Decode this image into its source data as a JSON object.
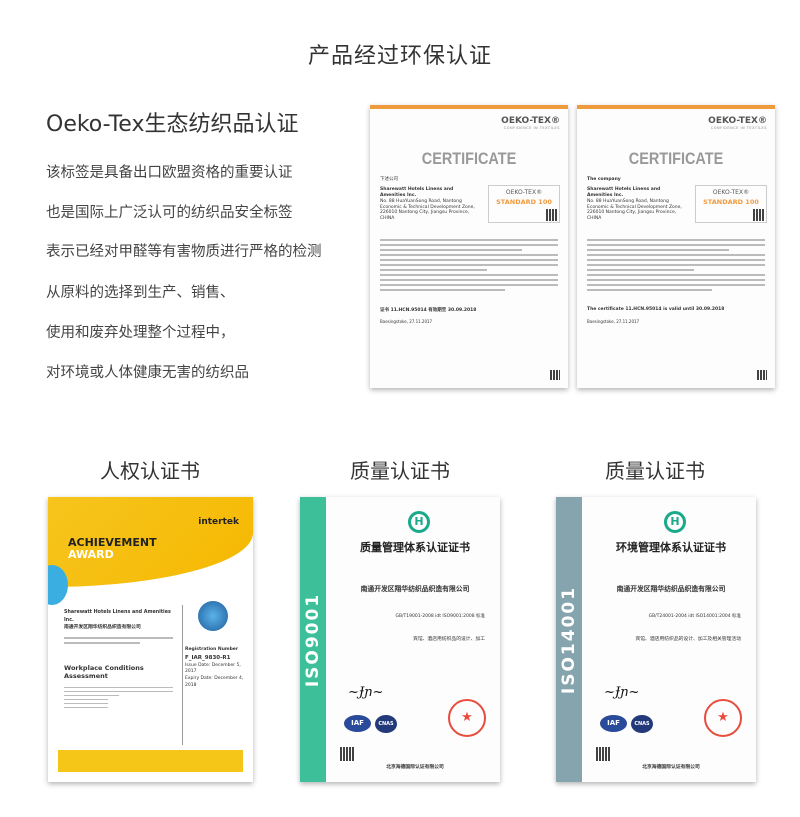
{
  "title": "产品经过环保认证",
  "oeko": {
    "heading": "Oeko-Tex生态纺织品认证",
    "lines": [
      "该标签是具备出口欧盟资格的重要认证",
      "也是国际上广泛认可的纺织品安全标签",
      "表示已经对甲醛等有害物质进行严格的检测",
      "从原料的选择到生产、销售、",
      "使用和废弃处理整个过程中，",
      "对环境或人体健康无害的纺织品"
    ]
  },
  "oeko_certs": [
    {
      "brand": "OEKO-TEX®",
      "tagline": "CONFIDENCE IN TEXTILES",
      "title": "CERTIFICATE",
      "intro": "下述公司",
      "company": "Sharewatt Hotels Linens and Amenities Inc.",
      "address": "No. 88 HuaYuanSong Road, Nantong Economic & Technical Development Zone, 226010 Nantong City, Jiangsu Province, CHINA",
      "box_brand": "OEKO-TEX®",
      "box_std": "STANDARD 100",
      "valid": "证书 11.HCN.95014 有效期至 30.09.2018",
      "date": "Baesingstoke, 27.11.2017"
    },
    {
      "brand": "OEKO-TEX®",
      "tagline": "CONFIDENCE IN TEXTILES",
      "title": "CERTIFICATE",
      "intro": "The company",
      "company": "Sharewatt Hotels Linens and Amenities Inc.",
      "address": "No. 88 HuaYuanSong Road, Nantong Economic & Technical Development Zone, 226010 Nantong City, Jiangsu Province, CHINA",
      "box_brand": "OEKO-TEX®",
      "box_std": "STANDARD 100",
      "valid": "The certificate 11.HCN.95014 is valid until 30.09.2018",
      "date": "Baesingstoke, 27.11.2017"
    }
  ],
  "sections": [
    "人权认证书",
    "质量认证书",
    "质量认证书"
  ],
  "achievement": {
    "line1": "ACHIEVEMENT",
    "line2": "AWARD",
    "brand": "intertek",
    "company": "Sharewatt Hotels Linens and Amenities Inc.",
    "company_cn": "南通开发区翔华纺织品织造有限公司",
    "assessment": "Workplace Conditions Assessment",
    "reg_label": "Registration Number",
    "reg": "F_IAR_9830-R1",
    "issue": "Issue Date: December 5, 2017",
    "expiry": "Expiry Date: December 4, 2018"
  },
  "iso_certs": [
    {
      "band": "ISO9001",
      "band_color": "#3dbf9a",
      "logo": "H",
      "title": "质量管理体系认证证书",
      "company": "南通开发区翔华纺织品织造有限公司",
      "standard": "GB/T19001-2008 idt ISO9001:2008 标准",
      "scope": "宾馆、酒店用纺织品的设计、加工",
      "org": "北京海德国际认证有限公司",
      "iaf": "IAF",
      "cnas": "CNAS"
    },
    {
      "band": "ISO14001",
      "band_color": "#86a4ad",
      "logo": "H",
      "title": "环境管理体系认证证书",
      "company": "南通开发区翔华纺织品织造有限公司",
      "standard": "GB/T24001-2004 idt ISO14001:2004 标准",
      "scope": "宾馆、酒店用纺织品的设计、加工及相关管理活动",
      "org": "北京海德国际认证有限公司",
      "iaf": "IAF",
      "cnas": "CNAS"
    }
  ]
}
